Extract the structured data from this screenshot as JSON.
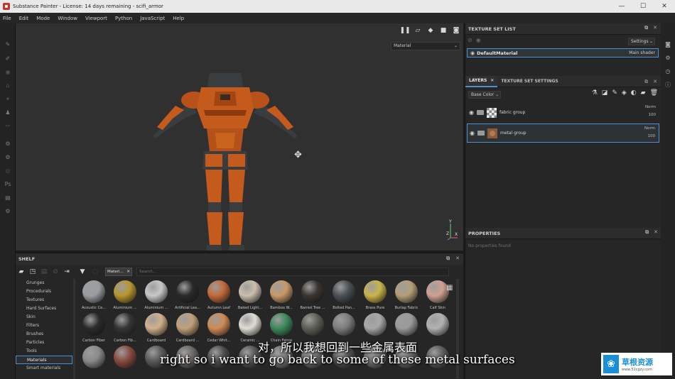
{
  "window": {
    "title": "Substance Painter - License: 14 days remaining - scifi_armor",
    "controls": [
      "—",
      "☐",
      "✕"
    ]
  },
  "menu": [
    "File",
    "Edit",
    "Mode",
    "Window",
    "Viewport",
    "Python",
    "JavaScript",
    "Help"
  ],
  "viewport": {
    "display_mode": "Material"
  },
  "texture_set_list": {
    "title": "TEXTURE SET LIST",
    "settings_label": "Settings",
    "material": "DefaultMaterial",
    "shader": "Main shader"
  },
  "layers": {
    "tabs": [
      "LAYERS",
      "TEXTURE SET SETTINGS"
    ],
    "channel": "Base Color",
    "items": [
      {
        "name": "fabric group",
        "blend": "Norm",
        "opacity": "100"
      },
      {
        "name": "metal group",
        "blend": "Norm",
        "opacity": "100"
      }
    ]
  },
  "properties": {
    "title": "PROPERTIES",
    "empty_text": "No properties found"
  },
  "shelf": {
    "title": "SHELF",
    "filter_chip": "Materi...",
    "search_placeholder": "Search...",
    "categories": [
      "Grunges",
      "Procedurals",
      "Textures",
      "Hard Surfaces",
      "Skin",
      "Filters",
      "Brushes",
      "Particles",
      "Tools",
      "Materials",
      "Smart materials"
    ],
    "active_category": "Materials",
    "materials_row1": [
      "Acoustic Ce...",
      "Aluminium ...",
      "Aluminium ...",
      "Artificial Lea...",
      "Autumn Leaf",
      "Baked Light...",
      "Bamboo W...",
      "Barred Tree ...",
      "Bolted Pan...",
      "Brass Pure",
      "Burlap Fabric",
      "Calf Skin"
    ],
    "materials_row2": [
      "Carbon Fiber",
      "Carbon Fib...",
      "Cardboard",
      "Cardboard ...",
      "Cedar Whit...",
      "Ceramic ...",
      "Chain Fence",
      "",
      "",
      "",
      "",
      ""
    ],
    "colors_row1": [
      "#9a9ea2",
      "#b8952f",
      "#c8c8c8",
      "#2a2a2a",
      "#c26a3a",
      "#cbbfad",
      "#c89a66",
      "#3a3530",
      "#4a5055",
      "#c9b54a",
      "#b59e78",
      "#d0a090"
    ],
    "colors_row2": [
      "#2b2b2b",
      "#353535",
      "#d2b08a",
      "#c2a07a",
      "#d08a55",
      "#e0dcd5",
      "#3d8a5a",
      "#5d6058",
      "#7d7d7d",
      "#a8a8a8",
      "#9a9a9a",
      "#b2b2b2"
    ],
    "colors_row3": [
      "#8a8a8a",
      "#8a4a40",
      "#5a5a5a",
      "#6d6a66",
      "#4d4d4d",
      "#555",
      "#777",
      "#6a6a6a",
      "#505050",
      "#707070",
      "#666",
      "#5d5d5d"
    ]
  },
  "subtitles": {
    "cn": "对，所以我想回到一些金属表面",
    "en": "right so i want to go back to some of these metal surfaces"
  },
  "watermark": {
    "name": "草根资源",
    "url": "www.52cgzy.com",
    "tiled_text": "www.52cgzy.com"
  },
  "colors": {
    "accent": "#4f8fcf",
    "armor_orange": "#c45a1c",
    "armor_dark": "#3a3d40"
  }
}
